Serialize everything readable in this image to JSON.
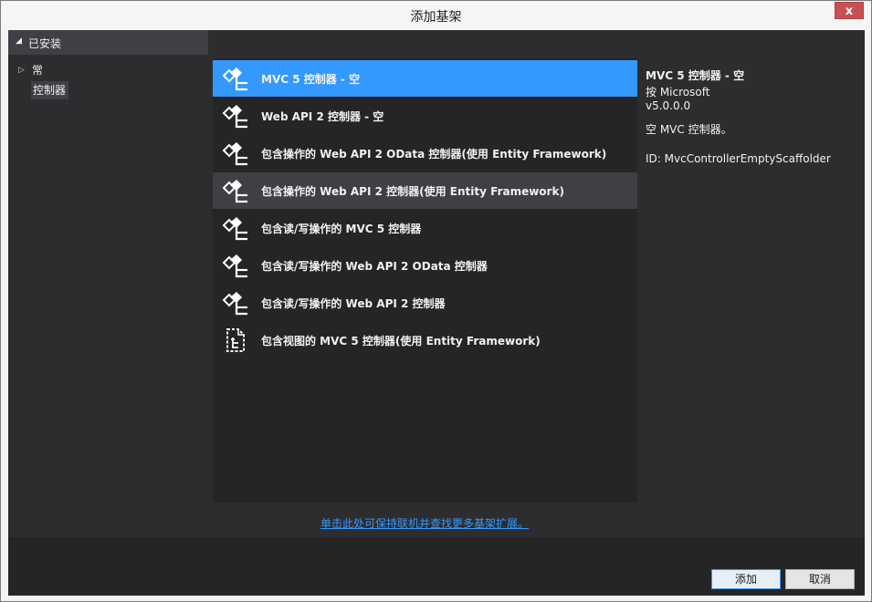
{
  "window": {
    "title": "添加基架",
    "close_label": "x"
  },
  "sidebar": {
    "header": "已安装",
    "items": [
      {
        "label": "常用"
      },
      {
        "label": "控制器"
      }
    ]
  },
  "templates": [
    {
      "label": "MVC 5 控制器 - 空",
      "icon": "controller-icon",
      "state": "selected"
    },
    {
      "label": "Web API 2 控制器 - 空",
      "icon": "controller-icon"
    },
    {
      "label": "包含操作的 Web API 2 OData 控制器(使用 Entity Framework)",
      "icon": "controller-icon"
    },
    {
      "label": "包含操作的 Web API 2 控制器(使用 Entity Framework)",
      "icon": "controller-icon",
      "state": "hover"
    },
    {
      "label": "包含读/写操作的 MVC 5 控制器",
      "icon": "controller-icon"
    },
    {
      "label": "包含读/写操作的 Web API 2 OData 控制器",
      "icon": "controller-icon"
    },
    {
      "label": "包含读/写操作的 Web API 2 控制器",
      "icon": "controller-icon"
    },
    {
      "label": "包含视图的 MVC 5 控制器(使用 Entity Framework)",
      "icon": "view-page-icon"
    }
  ],
  "details": {
    "name": "MVC 5 控制器 - 空",
    "by": "按 Microsoft",
    "version": "v5.0.0.0",
    "description": "空 MVC 控制器。",
    "id": "ID: MvcControllerEmptyScaffolder"
  },
  "extension_link": "单击此处可保持联机并查找更多基架扩展。",
  "buttons": {
    "add": "添加",
    "cancel": "取消"
  },
  "colors": {
    "accent": "#3399ff",
    "background": "#2d2d30",
    "list_background": "#252526"
  }
}
